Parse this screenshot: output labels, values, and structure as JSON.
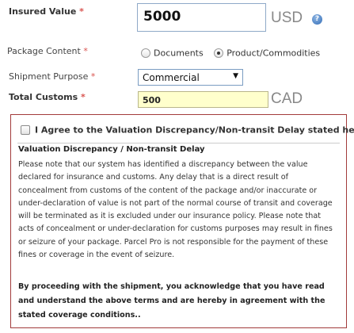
{
  "insured_value": {
    "label": "Insured Value",
    "required_mark": "*",
    "value": "5000",
    "currency": "USD",
    "help_glyph": "?"
  },
  "package_content": {
    "label": "Package Content",
    "required_mark": "*",
    "options": [
      {
        "label": "Documents",
        "selected": false
      },
      {
        "label": "Product/Commodities",
        "selected": true
      }
    ]
  },
  "shipment_purpose": {
    "label": "Shipment Purpose",
    "required_mark": "*",
    "selected": "Commercial",
    "arrow_glyph": "▼"
  },
  "total_customs": {
    "label": "Total Customs",
    "required_mark": "*",
    "value": "500",
    "currency": "CAD"
  },
  "disclaimer": {
    "agree_label": "I Agree to the Valuation Discrepancy/Non-transit Delay stated here",
    "agree_checked": false,
    "title": "Valuation Discrepancy / Non-transit Delay",
    "body_lines": [
      "Please note that our system has identified a discrepancy between the value",
      "declared for insurance and customs. Any delay that is a direct result of",
      "concealment from customs of the content of the package and/or inaccurate or",
      "under-declaration of value is not part of the normal course of transit and coverage",
      "will be terminated as it is excluded under our insurance policy. Please note that",
      "acts of concealment or under-declaration for customs purposes may result in fines",
      "or seizure of your package. Parcel Pro is not responsible for the payment of these",
      "fines or coverage in the event of seizure."
    ],
    "final_lines": [
      "By proceeding with the shipment, you acknowledge that you have read",
      "and understand the above terms and are hereby in agreement with the",
      "stated coverage conditions.."
    ]
  },
  "colors": {
    "required": "#d9534f",
    "panel_border": "#a23b3b",
    "customs_bg": "#ffffcc",
    "help_icon": "#4d82c4"
  },
  "icons": {
    "help": "help-icon",
    "select_arrow": "chevron-down-icon"
  }
}
